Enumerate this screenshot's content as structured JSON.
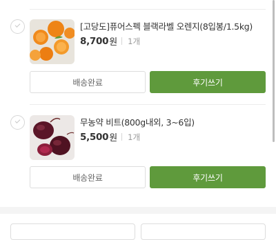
{
  "items": [
    {
      "name": "[고당도]퓨어스펙 블랙라벨 오렌지(8입봉/1.5kg)",
      "price": "8,700",
      "price_unit": "원",
      "quantity": "1개",
      "delivery_status": "배송완료",
      "review_label": "후기쓰기",
      "thumbnail_icon": "orange-product-image"
    },
    {
      "name": "무농약 비트(800g내외, 3~6입)",
      "price": "5,500",
      "price_unit": "원",
      "quantity": "1개",
      "delivery_status": "배송완료",
      "review_label": "후기쓰기",
      "thumbnail_icon": "beet-product-image"
    }
  ],
  "colors": {
    "accent_green": "#5f9a3c",
    "border_gray": "#dddddd",
    "section_gap": "#f4f4f4"
  }
}
